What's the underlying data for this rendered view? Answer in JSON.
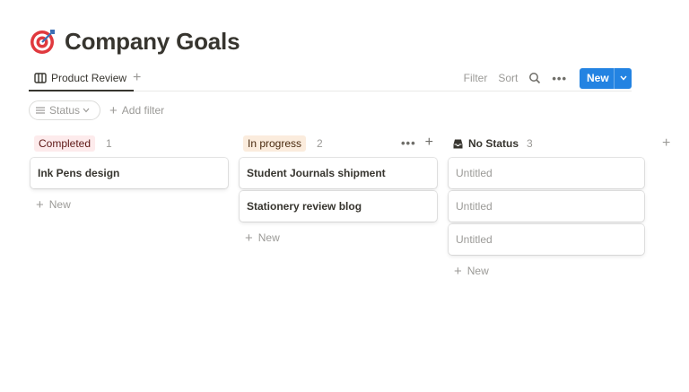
{
  "page": {
    "title": "Company Goals",
    "icon": "target-icon"
  },
  "view_tabs": {
    "active_tab": "Product Review",
    "add_view_label": "+"
  },
  "toolbar": {
    "filter_label": "Filter",
    "sort_label": "Sort",
    "search_icon": "search-icon",
    "more_icon": "more-icon",
    "new_label": "New",
    "accent_color": "#2383e2"
  },
  "filters": {
    "status_label": "Status",
    "add_filter_label": "Add filter"
  },
  "columns": [
    {
      "name": "Completed",
      "count": "1",
      "tag_bg": "#fdebec",
      "tag_fg": "#5d1715",
      "cards": [
        "Ink Pens design"
      ],
      "new_label": "New"
    },
    {
      "name": "In progress",
      "count": "2",
      "tag_bg": "#fbecdd",
      "tag_fg": "#49290e",
      "cards": [
        "Student Journals shipment",
        "Stationery review blog"
      ],
      "new_label": "New"
    },
    {
      "name": "No Status",
      "count": "3",
      "cards": [
        "Untitled",
        "Untitled",
        "Untitled"
      ],
      "new_label": "New"
    }
  ],
  "add_group_label": "+"
}
